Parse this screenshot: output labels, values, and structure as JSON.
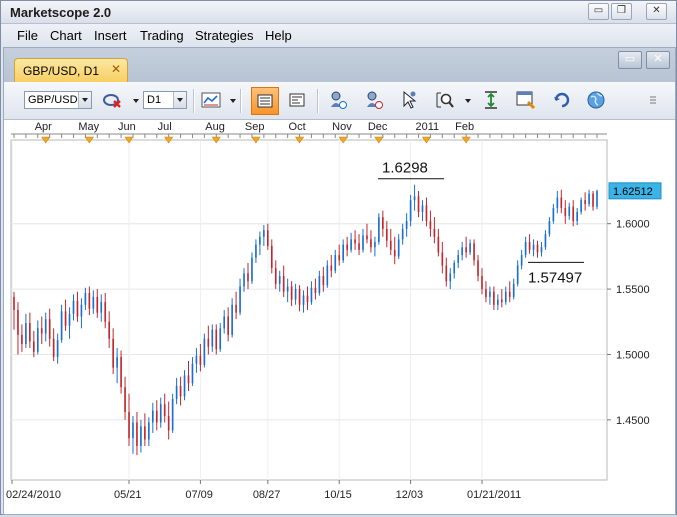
{
  "app": {
    "title": "Marketscope 2.0"
  },
  "window_controls": {
    "minimize": "▭",
    "restore": "❐",
    "close": "✕"
  },
  "menu": [
    "File",
    "Chart",
    "Insert",
    "Trading",
    "Strategies",
    "Help"
  ],
  "tab": {
    "label": "GBP/USD, D1",
    "close": "✕"
  },
  "doc_controls": {
    "restore": "▭",
    "close": "✕"
  },
  "toolbar": {
    "instrument": "GBP/USD",
    "timeframe": "D1"
  },
  "colors": {
    "up": "#1a6fd1",
    "down": "#c1272d",
    "price_badge": "#3bb3e6",
    "marker": "#f5a623",
    "tab": "#f7cf62"
  },
  "chart_data": {
    "type": "candlestick",
    "instrument": "GBP/USD",
    "timeframe": "D1",
    "months_top": [
      "Apr",
      "May",
      "Jun",
      "Jul",
      "Aug",
      "Sep",
      "Oct",
      "Nov",
      "Dec",
      "2011",
      "Feb"
    ],
    "x_labels": [
      "02/24/2010",
      "05/21",
      "07/09",
      "08/27",
      "10/15",
      "12/03",
      "01/21/2011"
    ],
    "y_ticks": [
      "1.6000",
      "1.5500",
      "1.5000",
      "1.4500"
    ],
    "y_tick_values": [
      1.6,
      1.55,
      1.5,
      1.45
    ],
    "ylim": [
      1.404,
      1.664
    ],
    "current_price": "1.62512",
    "annotations": [
      "1.6298",
      "1.57497"
    ],
    "grid": true,
    "series": [
      [
        1.544,
        1.548,
        1.519,
        1.534
      ],
      [
        1.534,
        1.54,
        1.5,
        1.515
      ],
      [
        1.515,
        1.523,
        1.502,
        1.508
      ],
      [
        1.508,
        1.531,
        1.505,
        1.524
      ],
      [
        1.524,
        1.532,
        1.505,
        1.51
      ],
      [
        1.51,
        1.518,
        1.498,
        1.502
      ],
      [
        1.502,
        1.526,
        1.5,
        1.52
      ],
      [
        1.52,
        1.529,
        1.508,
        1.516
      ],
      [
        1.516,
        1.532,
        1.51,
        1.527
      ],
      [
        1.527,
        1.535,
        1.506,
        1.512
      ],
      [
        1.512,
        1.52,
        1.495,
        1.498
      ],
      [
        1.498,
        1.516,
        1.493,
        1.511
      ],
      [
        1.511,
        1.538,
        1.509,
        1.533
      ],
      [
        1.533,
        1.542,
        1.518,
        1.522
      ],
      [
        1.522,
        1.536,
        1.512,
        1.531
      ],
      [
        1.531,
        1.546,
        1.526,
        1.541
      ],
      [
        1.541,
        1.548,
        1.525,
        1.529
      ],
      [
        1.529,
        1.543,
        1.52,
        1.538
      ],
      [
        1.538,
        1.551,
        1.534,
        1.547
      ],
      [
        1.547,
        1.552,
        1.53,
        1.535
      ],
      [
        1.535,
        1.549,
        1.531,
        1.544
      ],
      [
        1.544,
        1.55,
        1.528,
        1.532
      ],
      [
        1.532,
        1.546,
        1.525,
        1.54
      ],
      [
        1.54,
        1.547,
        1.52,
        1.525
      ],
      [
        1.525,
        1.533,
        1.505,
        1.512
      ],
      [
        1.512,
        1.52,
        1.485,
        1.49
      ],
      [
        1.49,
        1.505,
        1.478,
        1.498
      ],
      [
        1.498,
        1.503,
        1.47,
        1.475
      ],
      [
        1.475,
        1.483,
        1.45,
        1.456
      ],
      [
        1.456,
        1.47,
        1.43,
        1.436
      ],
      [
        1.436,
        1.453,
        1.424,
        1.448
      ],
      [
        1.448,
        1.456,
        1.423,
        1.43
      ],
      [
        1.43,
        1.45,
        1.425,
        1.445
      ],
      [
        1.445,
        1.455,
        1.43,
        1.435
      ],
      [
        1.435,
        1.452,
        1.43,
        1.448
      ],
      [
        1.448,
        1.463,
        1.44,
        1.457
      ],
      [
        1.457,
        1.465,
        1.442,
        1.448
      ],
      [
        1.448,
        1.467,
        1.444,
        1.462
      ],
      [
        1.462,
        1.47,
        1.448,
        1.453
      ],
      [
        1.453,
        1.464,
        1.435,
        1.442
      ],
      [
        1.442,
        1.47,
        1.44,
        1.466
      ],
      [
        1.466,
        1.482,
        1.462,
        1.476
      ],
      [
        1.476,
        1.483,
        1.461,
        1.468
      ],
      [
        1.468,
        1.488,
        1.465,
        1.484
      ],
      [
        1.484,
        1.495,
        1.472,
        1.478
      ],
      [
        1.478,
        1.498,
        1.476,
        1.493
      ],
      [
        1.493,
        1.505,
        1.486,
        1.499
      ],
      [
        1.499,
        1.508,
        1.487,
        1.492
      ],
      [
        1.492,
        1.516,
        1.49,
        1.512
      ],
      [
        1.512,
        1.522,
        1.5,
        1.506
      ],
      [
        1.506,
        1.523,
        1.502,
        1.519
      ],
      [
        1.519,
        1.523,
        1.5,
        1.504
      ],
      [
        1.504,
        1.524,
        1.502,
        1.52
      ],
      [
        1.52,
        1.534,
        1.516,
        1.529
      ],
      [
        1.529,
        1.536,
        1.51,
        1.515
      ],
      [
        1.515,
        1.543,
        1.513,
        1.538
      ],
      [
        1.538,
        1.548,
        1.527,
        1.532
      ],
      [
        1.532,
        1.558,
        1.53,
        1.552
      ],
      [
        1.552,
        1.566,
        1.548,
        1.562
      ],
      [
        1.562,
        1.57,
        1.55,
        1.556
      ],
      [
        1.556,
        1.578,
        1.554,
        1.574
      ],
      [
        1.574,
        1.588,
        1.57,
        1.584
      ],
      [
        1.584,
        1.594,
        1.576,
        1.59
      ],
      [
        1.59,
        1.599,
        1.583,
        1.595
      ],
      [
        1.595,
        1.6,
        1.58,
        1.583
      ],
      [
        1.583,
        1.588,
        1.562,
        1.566
      ],
      [
        1.566,
        1.572,
        1.55,
        1.554
      ],
      [
        1.554,
        1.564,
        1.548,
        1.56
      ],
      [
        1.56,
        1.568,
        1.544,
        1.548
      ],
      [
        1.548,
        1.558,
        1.54,
        1.552
      ],
      [
        1.552,
        1.556,
        1.537,
        1.542
      ],
      [
        1.542,
        1.554,
        1.538,
        1.55
      ],
      [
        1.55,
        1.553,
        1.533,
        1.538
      ],
      [
        1.538,
        1.549,
        1.532,
        1.545
      ],
      [
        1.545,
        1.552,
        1.534,
        1.54
      ],
      [
        1.54,
        1.556,
        1.538,
        1.551
      ],
      [
        1.551,
        1.558,
        1.542,
        1.547
      ],
      [
        1.547,
        1.564,
        1.545,
        1.56
      ],
      [
        1.56,
        1.567,
        1.548,
        1.553
      ],
      [
        1.553,
        1.572,
        1.551,
        1.568
      ],
      [
        1.568,
        1.576,
        1.559,
        1.564
      ],
      [
        1.564,
        1.58,
        1.562,
        1.576
      ],
      [
        1.576,
        1.584,
        1.568,
        1.572
      ],
      [
        1.572,
        1.588,
        1.57,
        1.584
      ],
      [
        1.584,
        1.59,
        1.575,
        1.58
      ],
      [
        1.58,
        1.593,
        1.578,
        1.588
      ],
      [
        1.588,
        1.595,
        1.58,
        1.585
      ],
      [
        1.585,
        1.592,
        1.576,
        1.58
      ],
      [
        1.58,
        1.596,
        1.578,
        1.591
      ],
      [
        1.591,
        1.6,
        1.585,
        1.588
      ],
      [
        1.588,
        1.595,
        1.578,
        1.582
      ],
      [
        1.582,
        1.59,
        1.575,
        1.586
      ],
      [
        1.586,
        1.608,
        1.584,
        1.605
      ],
      [
        1.605,
        1.61,
        1.59,
        1.596
      ],
      [
        1.596,
        1.602,
        1.582,
        1.587
      ],
      [
        1.587,
        1.596,
        1.576,
        1.58
      ],
      [
        1.58,
        1.59,
        1.569,
        1.575
      ],
      [
        1.575,
        1.592,
        1.573,
        1.588
      ],
      [
        1.588,
        1.6,
        1.584,
        1.596
      ],
      [
        1.596,
        1.608,
        1.59,
        1.602
      ],
      [
        1.602,
        1.622,
        1.598,
        1.618
      ],
      [
        1.618,
        1.6298,
        1.61,
        1.621
      ],
      [
        1.621,
        1.625,
        1.605,
        1.609
      ],
      [
        1.609,
        1.618,
        1.602,
        1.614
      ],
      [
        1.614,
        1.62,
        1.598,
        1.602
      ],
      [
        1.602,
        1.61,
        1.59,
        1.596
      ],
      [
        1.596,
        1.605,
        1.585,
        1.59
      ],
      [
        1.59,
        1.596,
        1.575,
        1.578
      ],
      [
        1.578,
        1.586,
        1.562,
        1.568
      ],
      [
        1.568,
        1.574,
        1.552,
        1.556
      ],
      [
        1.556,
        1.566,
        1.55,
        1.562
      ],
      [
        1.562,
        1.572,
        1.558,
        1.57
      ],
      [
        1.57,
        1.58,
        1.566,
        1.576
      ],
      [
        1.576,
        1.586,
        1.572,
        1.582
      ],
      [
        1.582,
        1.59,
        1.574,
        1.578
      ],
      [
        1.578,
        1.588,
        1.576,
        1.585
      ],
      [
        1.585,
        1.588,
        1.568,
        1.572
      ],
      [
        1.572,
        1.576,
        1.556,
        1.56
      ],
      [
        1.56,
        1.566,
        1.546,
        1.55
      ],
      [
        1.55,
        1.556,
        1.54,
        1.544
      ],
      [
        1.544,
        1.552,
        1.538,
        1.548
      ],
      [
        1.548,
        1.552,
        1.534,
        1.538
      ],
      [
        1.538,
        1.546,
        1.534,
        1.542
      ],
      [
        1.542,
        1.55,
        1.536,
        1.54
      ],
      [
        1.54,
        1.552,
        1.538,
        1.548
      ],
      [
        1.548,
        1.556,
        1.54,
        1.544
      ],
      [
        1.544,
        1.558,
        1.542,
        1.554
      ],
      [
        1.554,
        1.572,
        1.552,
        1.568
      ],
      [
        1.568,
        1.58,
        1.565,
        1.576
      ],
      [
        1.576,
        1.59,
        1.574,
        1.586
      ],
      [
        1.586,
        1.592,
        1.577,
        1.58
      ],
      [
        1.58,
        1.588,
        1.575,
        1.584
      ],
      [
        1.584,
        1.587,
        1.574,
        1.578
      ],
      [
        1.578,
        1.586,
        1.5749,
        1.582
      ],
      [
        1.582,
        1.595,
        1.58,
        1.592
      ],
      [
        1.592,
        1.605,
        1.59,
        1.602
      ],
      [
        1.602,
        1.615,
        1.6,
        1.612
      ],
      [
        1.612,
        1.625,
        1.608,
        1.62
      ],
      [
        1.62,
        1.626,
        1.608,
        1.612
      ],
      [
        1.612,
        1.618,
        1.6,
        1.606
      ],
      [
        1.606,
        1.616,
        1.603,
        1.613
      ],
      [
        1.613,
        1.618,
        1.598,
        1.602
      ],
      [
        1.602,
        1.612,
        1.599,
        1.609
      ],
      [
        1.609,
        1.62,
        1.607,
        1.618
      ],
      [
        1.618,
        1.624,
        1.61,
        1.615
      ],
      [
        1.615,
        1.626,
        1.613,
        1.623
      ],
      [
        1.623,
        1.625,
        1.61,
        1.613
      ],
      [
        1.613,
        1.626,
        1.611,
        1.6251
      ]
    ]
  }
}
